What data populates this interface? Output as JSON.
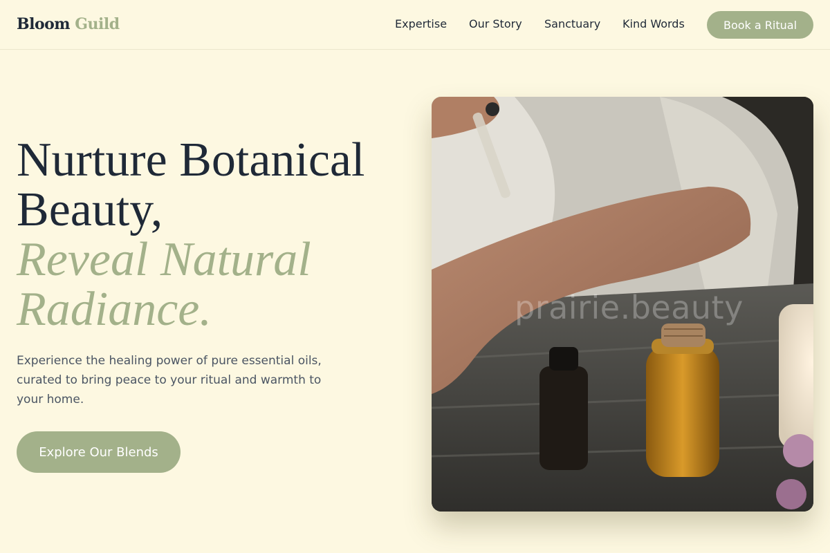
{
  "brand": {
    "part1": "Bloom",
    "part2": "Guild"
  },
  "nav": {
    "links": [
      {
        "label": "Expertise"
      },
      {
        "label": "Our Story"
      },
      {
        "label": "Sanctuary"
      },
      {
        "label": "Kind Words"
      }
    ],
    "cta_label": "Book a Ritual"
  },
  "hero": {
    "title_line1": "Nurture Botanical",
    "title_line2": "Beauty,",
    "accent_line1": "Reveal Natural",
    "accent_line2": "Radiance.",
    "lead": "Experience the healing power of pure essential oils, curated to bring peace to your ritual and warmth to your home.",
    "button_label": "Explore Our Blends"
  },
  "image": {
    "watermark": "prairie.beauty"
  },
  "colors": {
    "background": "#fdf8e1",
    "accent": "#a3b18a",
    "text": "#1f2937",
    "muted": "#4b5563"
  }
}
